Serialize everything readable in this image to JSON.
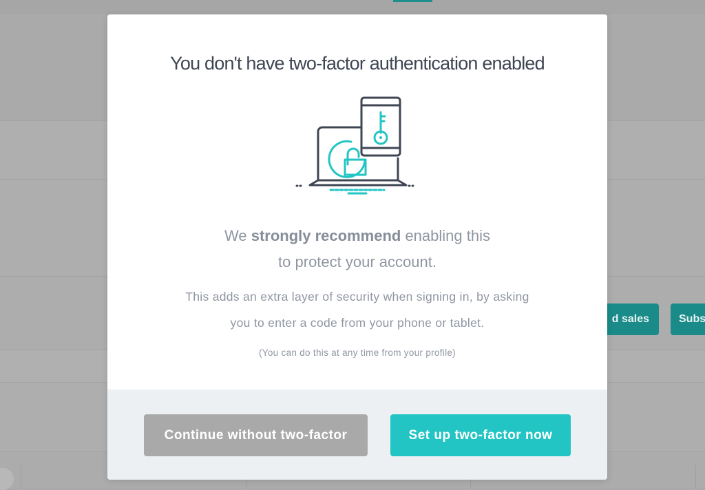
{
  "colors": {
    "accent": "#22c5c3",
    "secondary_button": "#a9a9a9",
    "title_text": "#3f4653",
    "body_text": "#8f96a2",
    "footer_bg": "#edf0f2",
    "overlay_bg": "#acacac",
    "illustration_line": "#3f4653"
  },
  "background": {
    "buttons": [
      {
        "label": "d sales",
        "icon": null
      },
      {
        "label": "Subs",
        "icon": null
      }
    ]
  },
  "modal": {
    "title": "You don't have two-factor authentication enabled",
    "illustration": {
      "icon": "laptop-phone-key-icon"
    },
    "lead": {
      "prefix": "We ",
      "strong": "strongly recommend",
      "suffix": " enabling this",
      "line2": "to protect your account."
    },
    "body": {
      "line1": "This adds an extra layer of security when signing in, by asking",
      "line2": "you to enter a code from your phone or tablet."
    },
    "note": "(You can do this at any time from your profile)",
    "buttons": {
      "continue_label": "Continue without two-factor",
      "setup_label": "Set up two-factor now"
    }
  }
}
